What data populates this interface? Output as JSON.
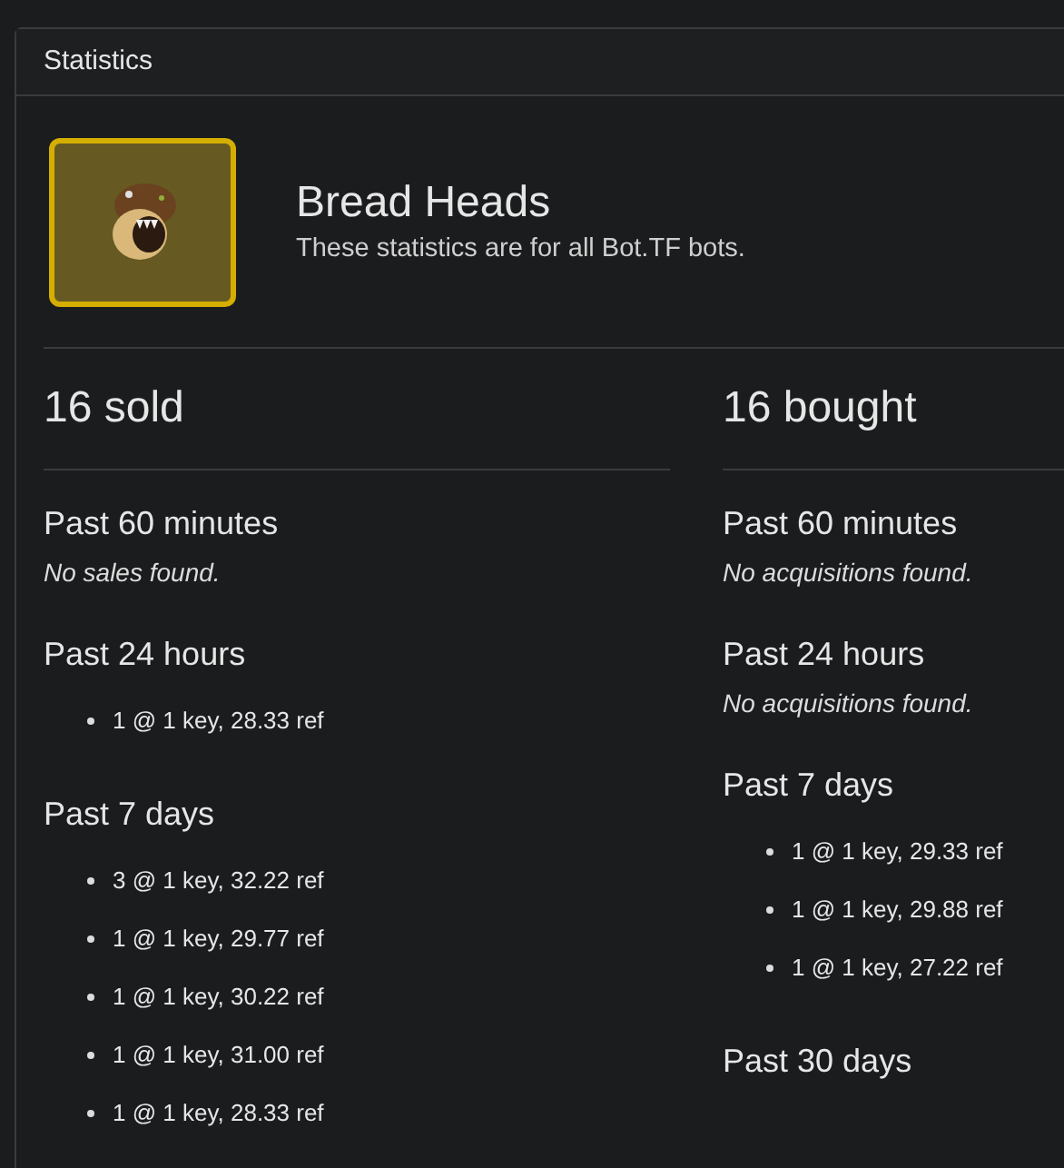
{
  "panel": {
    "title": "Statistics"
  },
  "item": {
    "name": "Bread Heads",
    "subtitle": "These statistics are for all Bot.TF bots."
  },
  "columns": [
    {
      "heading": "16 sold",
      "sections": [
        {
          "title": "Past 60 minutes",
          "empty_message": "No sales found."
        },
        {
          "title": "Past 24 hours",
          "entries": [
            "1 @ 1 key, 28.33 ref"
          ]
        },
        {
          "title": "Past 7 days",
          "entries": [
            "3 @ 1 key, 32.22 ref",
            "1 @ 1 key, 29.77 ref",
            "1 @ 1 key, 30.22 ref",
            "1 @ 1 key, 31.00 ref",
            "1 @ 1 key, 28.33 ref"
          ]
        }
      ]
    },
    {
      "heading": "16 bought",
      "sections": [
        {
          "title": "Past 60 minutes",
          "empty_message": "No acquisitions found."
        },
        {
          "title": "Past 24 hours",
          "empty_message": "No acquisitions found."
        },
        {
          "title": "Past 7 days",
          "entries": [
            "1 @ 1 key, 29.33 ref",
            "1 @ 1 key, 29.88 ref",
            "1 @ 1 key, 27.22 ref"
          ]
        },
        {
          "title": "Past 30 days"
        }
      ]
    }
  ]
}
